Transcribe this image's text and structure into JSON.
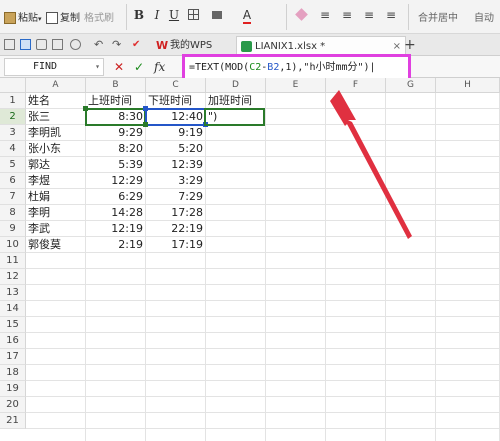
{
  "ribbon": {
    "paste_label": "粘贴",
    "copy_label": "复制",
    "format_painter_label": "格式刷",
    "bold": "B",
    "italic": "I",
    "underline": "U",
    "merge_label": "合并居中",
    "auto_label": "自动"
  },
  "tabs": {
    "home_tab_label": "我的WPS",
    "file_tab_label": "LIANIX1.xlsx *",
    "close_label": "×",
    "add_label": "+"
  },
  "formula_bar": {
    "name_box": "FIND",
    "cancel_label": "✕",
    "confirm_label": "✓",
    "fx_label": "fx",
    "formula_prefix": "=TEXT(MOD(",
    "ref_c2": "C2",
    "minus": "-",
    "ref_b2": "B2",
    "formula_suffix": ",1),\"h小时mm分\")|"
  },
  "columns": [
    "A",
    "B",
    "C",
    "D",
    "E",
    "F",
    "G",
    "H"
  ],
  "rows": [
    "1",
    "2",
    "3",
    "4",
    "5",
    "6",
    "7",
    "8",
    "9",
    "10",
    "11",
    "12",
    "13",
    "14",
    "15",
    "16",
    "17",
    "18",
    "19",
    "20",
    "21"
  ],
  "sheet": {
    "headers": [
      "姓名",
      "上班时间",
      "下班时间",
      "加班时间"
    ],
    "data": [
      [
        "张三",
        "8:30",
        "12:40",
        "\")"
      ],
      [
        "李明凯",
        "9:29",
        "9:19",
        ""
      ],
      [
        "张小东",
        "8:20",
        "5:20",
        ""
      ],
      [
        "郭达",
        "5:39",
        "12:39",
        ""
      ],
      [
        "李煜",
        "12:29",
        "3:29",
        ""
      ],
      [
        "杜娟",
        "6:29",
        "7:29",
        ""
      ],
      [
        "李明",
        "14:28",
        "17:28",
        ""
      ],
      [
        "李武",
        "12:19",
        "22:19",
        ""
      ],
      [
        "郭俊莫",
        "2:19",
        "17:19",
        ""
      ]
    ]
  },
  "colors": {
    "highlight_border": "#e040e0",
    "arrow": "#e03040",
    "selection_green": "#2a7a2a",
    "reference_blue": "#2456c8"
  }
}
